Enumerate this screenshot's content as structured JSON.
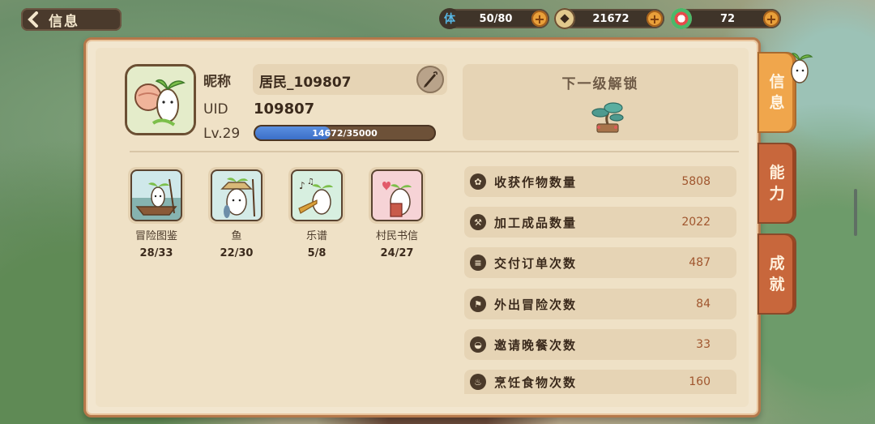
{
  "header": {
    "back_label": "信息"
  },
  "resources": [
    {
      "icon": "stamina-icon",
      "icon_text": "体",
      "value": "50/80"
    },
    {
      "icon": "coin-icon",
      "icon_text": "",
      "value": "21672"
    },
    {
      "icon": "gem-icon",
      "icon_text": "",
      "value": "72"
    }
  ],
  "profile": {
    "nickname_label": "昵称",
    "nickname": "居民_109807",
    "uid_label": "UID",
    "uid": "109807",
    "level_label": "Lv.29",
    "xp_text": "14672/35000",
    "xp_fraction": 0.419
  },
  "unlock": {
    "title": "下一级解锁"
  },
  "collections": [
    {
      "name": "冒险图鉴",
      "count": "28/33"
    },
    {
      "name": "鱼",
      "count": "22/30"
    },
    {
      "name": "乐谱",
      "count": "5/8"
    },
    {
      "name": "村民书信",
      "count": "24/27"
    }
  ],
  "stats": [
    {
      "label": "收获作物数量",
      "value": "5808"
    },
    {
      "label": "加工成品数量",
      "value": "2022"
    },
    {
      "label": "交付订单次数",
      "value": "487"
    },
    {
      "label": "外出冒险次数",
      "value": "84"
    },
    {
      "label": "邀请晚餐次数",
      "value": "33"
    },
    {
      "label": "烹饪食物次数",
      "value": "160"
    }
  ],
  "tabs": [
    {
      "label_top": "信",
      "label_bottom": "息"
    },
    {
      "label_top": "能",
      "label_bottom": "力"
    },
    {
      "label_top": "成",
      "label_bottom": "就"
    }
  ]
}
